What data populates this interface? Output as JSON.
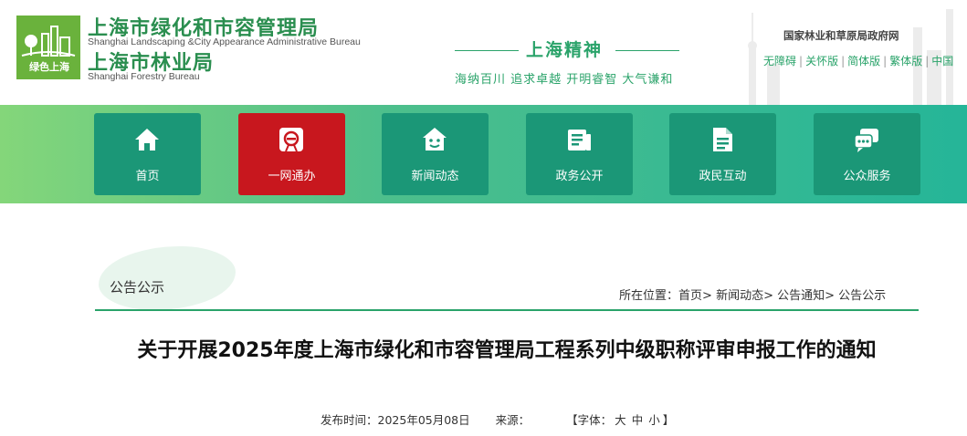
{
  "header": {
    "logo_text": "绿色上海",
    "title_cn_1": "上海市绿化和市容管理局",
    "title_en_1": "Shanghai Landscaping &City Appearance Administrative Bureau",
    "title_cn_2": "上海市林业局",
    "title_en_2": "Shanghai Forestry Bureau",
    "slogan_title": "上海精神",
    "slogan_sub": "海纳百川 追求卓越 开明睿智 大气谦和",
    "gov_link": "国家林业和草原局政府网",
    "top_links": [
      "无障碍",
      "关怀版",
      "简体版",
      "繁体版",
      "中国"
    ]
  },
  "nav": {
    "items": [
      {
        "label": "首页",
        "icon": "home-icon"
      },
      {
        "label": "一网通办",
        "icon": "one-stop-icon"
      },
      {
        "label": "新闻动态",
        "icon": "news-icon"
      },
      {
        "label": "政务公开",
        "icon": "gov-affairs-icon"
      },
      {
        "label": "政民互动",
        "icon": "document-icon"
      },
      {
        "label": "公众服务",
        "icon": "chat-icon"
      }
    ],
    "active_index": 1
  },
  "content": {
    "section_title": "公告公示",
    "breadcrumb_prefix": "所在位置：",
    "breadcrumb": [
      "首页",
      "新闻动态",
      "公告通知",
      "公告公示"
    ],
    "article_title": "关于开展2025年度上海市绿化和市容管理局工程系列中级职称评审申报工作的通知",
    "publish_label": "发布时间：",
    "publish_date": "2025年05月08日",
    "source_label": "来源：",
    "font_label": "【字体：",
    "font_sizes": [
      "大",
      "中",
      "小"
    ],
    "font_close": "】"
  },
  "colors": {
    "green": "#2aa36a",
    "nav_tile": "#1b9777",
    "nav_active": "#c8171e"
  }
}
